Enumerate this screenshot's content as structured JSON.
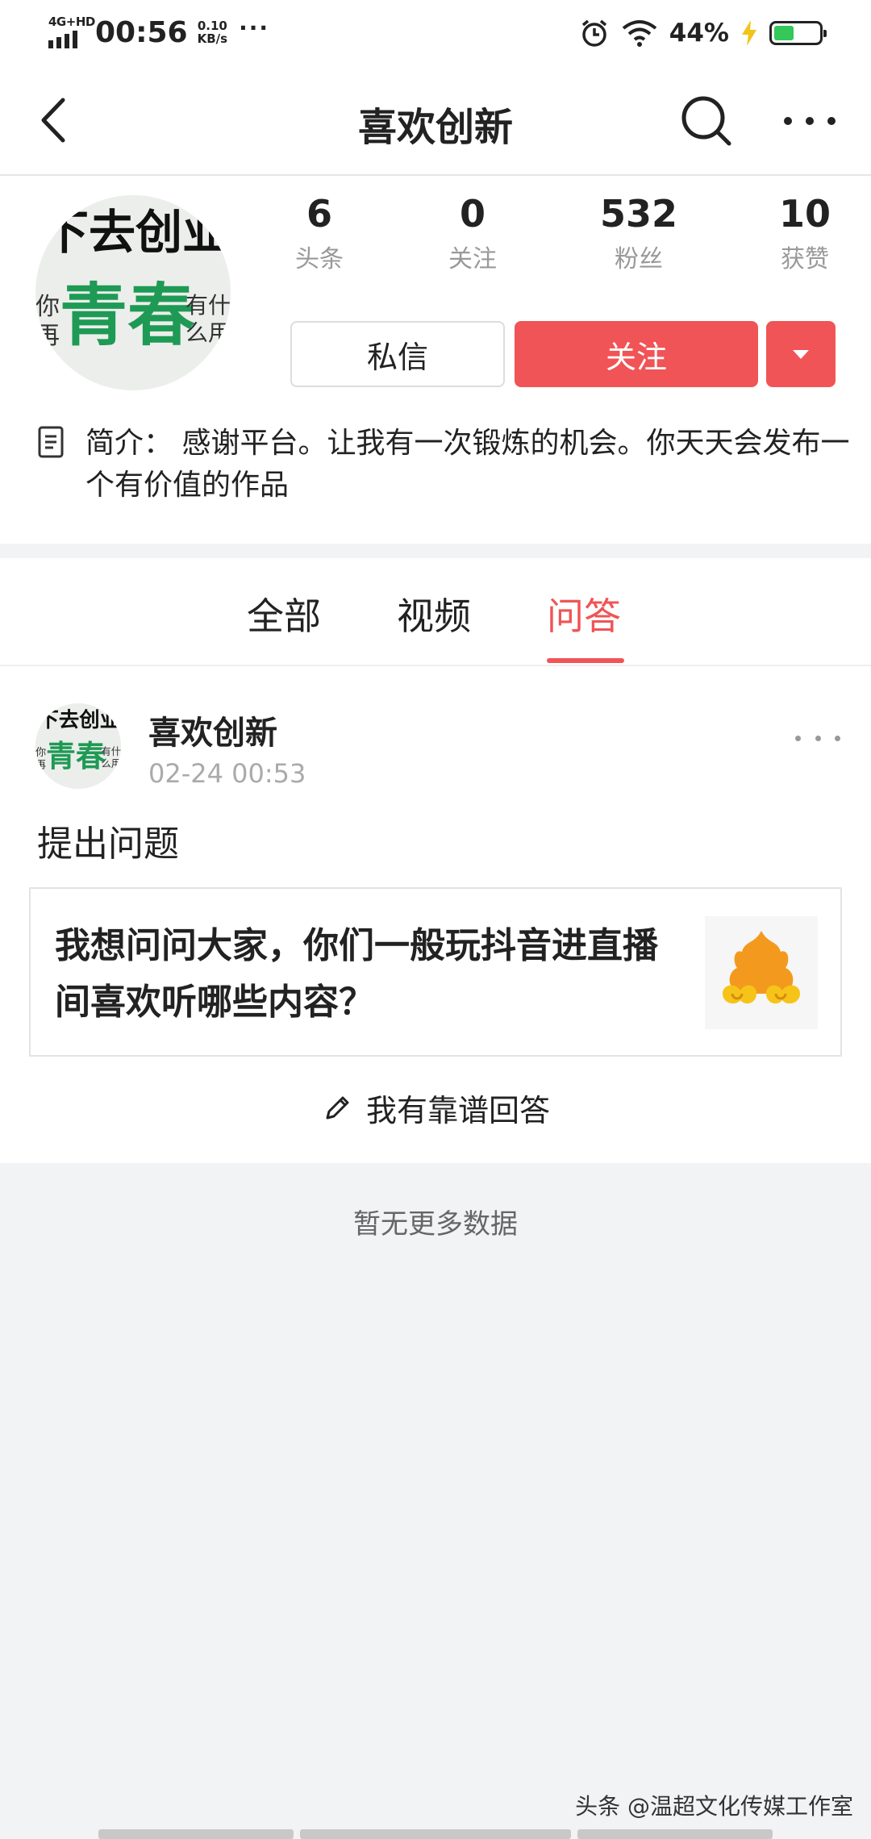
{
  "status_bar": {
    "network": "4G+HD",
    "time": "00:56",
    "speed_value": "0.10",
    "speed_unit": "KB/s",
    "more": "···",
    "battery_pct": "44%",
    "battery_level": 0.44,
    "icons": [
      "signal-icon",
      "alarm-icon",
      "wifi-icon",
      "charging-icon",
      "battery-icon"
    ]
  },
  "nav": {
    "title": "喜欢创新",
    "icons": [
      "back-icon",
      "search-icon",
      "more-icon"
    ]
  },
  "profile": {
    "avatar_text": {
      "top": "下去创业",
      "main": "青春",
      "left_1": "你",
      "left_2": "再",
      "right_1": "有什",
      "right_2": "么用"
    },
    "stats": [
      {
        "value": "6",
        "label": "头条"
      },
      {
        "value": "0",
        "label": "关注"
      },
      {
        "value": "532",
        "label": "粉丝"
      },
      {
        "value": "10",
        "label": "获赞"
      }
    ],
    "message_button": "私信",
    "follow_button": "关注",
    "bio": "简介： 感谢平台。让我有一次锻炼的机会。你天天会发布一个有价值的作品"
  },
  "tabs": [
    {
      "label": "全部",
      "active": false
    },
    {
      "label": "视频",
      "active": false
    },
    {
      "label": "问答",
      "active": true
    }
  ],
  "post": {
    "author": "喜欢创新",
    "time": "02-24 00:53",
    "type": "提出问题",
    "question": "我想问问大家，你们一般玩抖音进直播间喜欢听哪些内容？",
    "answer_link": "我有靠谱回答"
  },
  "footer": {
    "no_more": "暂无更多数据",
    "watermark": "头条 @温超文化传媒工作室"
  },
  "colors": {
    "accent": "#f05456",
    "text": "#222222",
    "muted": "#999999",
    "background": "#f2f3f5",
    "avatar_green": "#1e9a55"
  }
}
